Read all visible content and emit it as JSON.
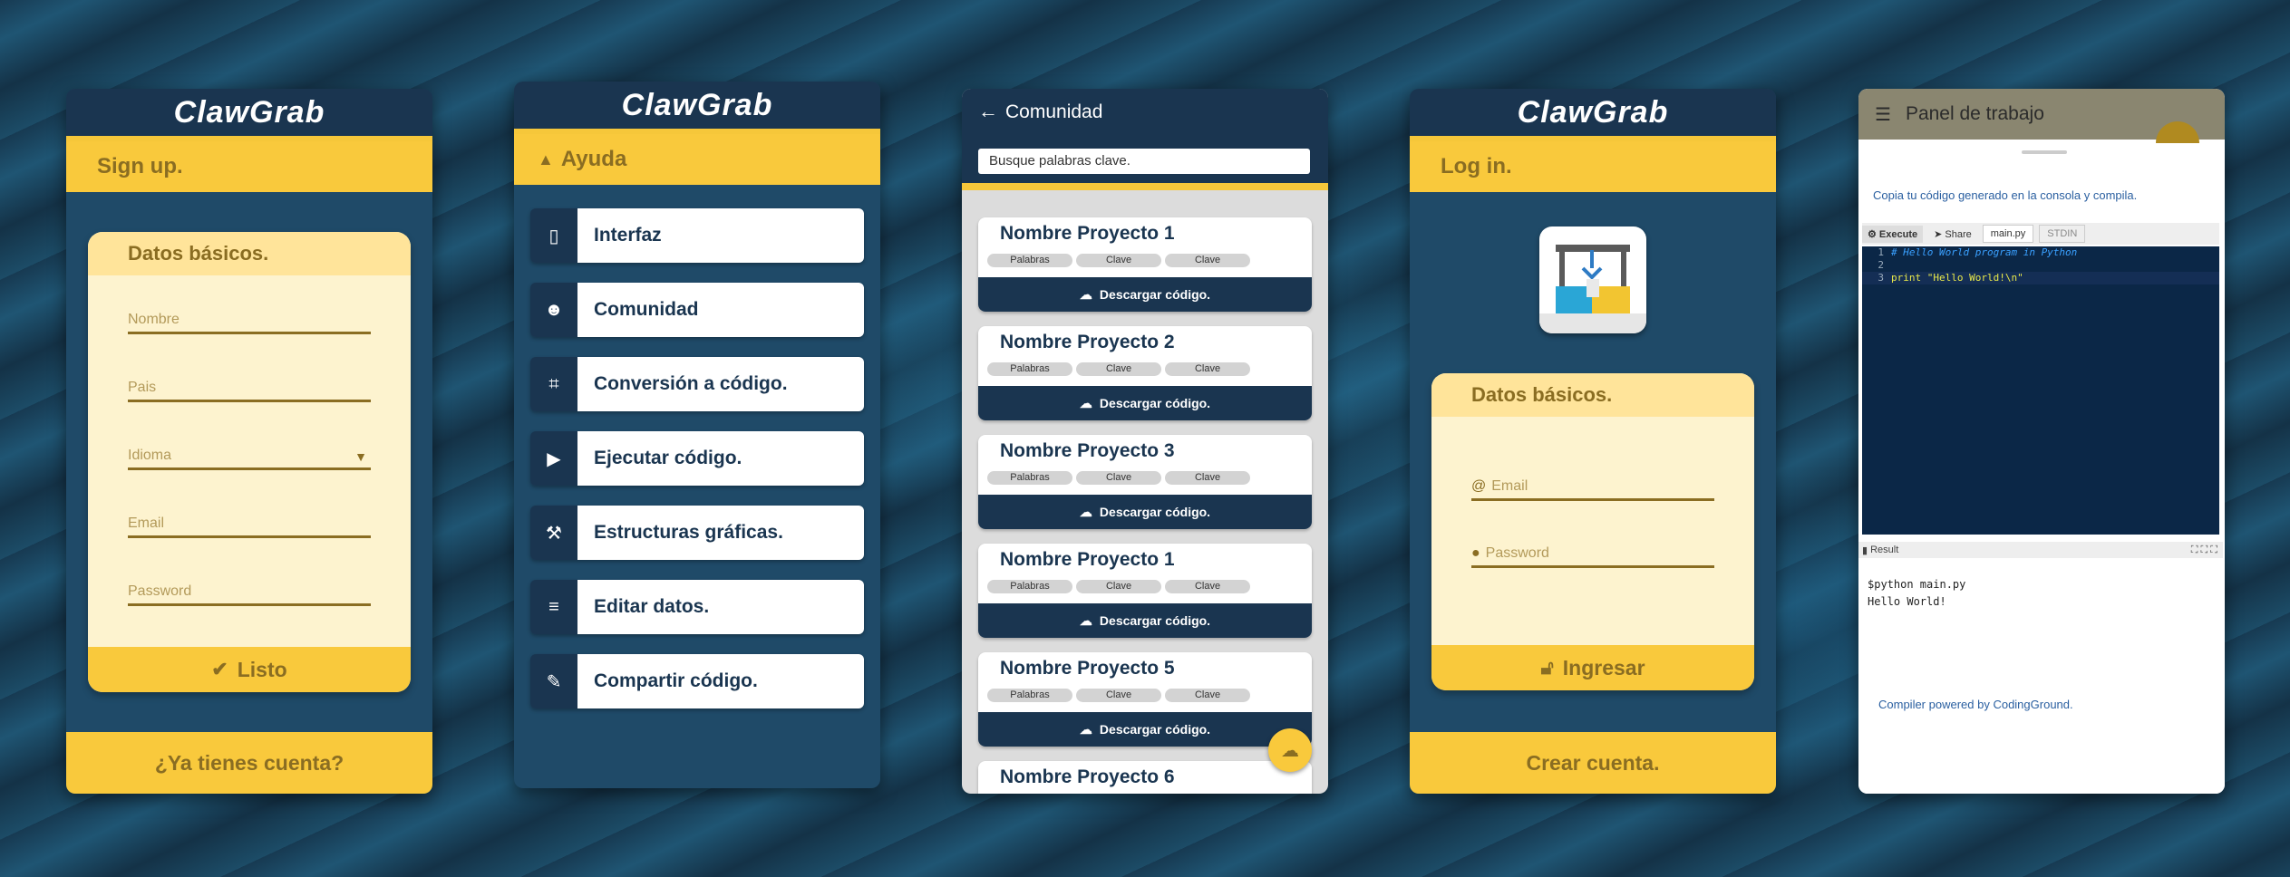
{
  "brand": "ClawGrab",
  "signup": {
    "header": "Sign up.",
    "card_title": "Datos básicos.",
    "fields": [
      "Nombre",
      "Pais",
      "Idioma",
      "Email",
      "Password"
    ],
    "submit": "Listo",
    "bottom": "¿Ya tienes cuenta?"
  },
  "help": {
    "header": "Ayuda",
    "items": [
      "Interfaz",
      "Comunidad",
      "Conversión a código.",
      "Ejecutar código.",
      "Estructuras gráficas.",
      "Editar datos.",
      "Compartir código."
    ]
  },
  "community": {
    "title": "Comunidad",
    "search_placeholder": "Busque palabras clave.",
    "chips": [
      "Palabras",
      "Clave",
      "Clave"
    ],
    "download": "Descargar código.",
    "projects": [
      "Nombre Proyecto 1",
      "Nombre Proyecto 2",
      "Nombre Proyecto 3",
      "Nombre Proyecto 1",
      "Nombre Proyecto 5",
      "Nombre Proyecto 6"
    ]
  },
  "login": {
    "header": "Log in.",
    "card_title": "Datos básicos.",
    "email": "Email",
    "password": "Password",
    "submit": "Ingresar",
    "bottom": "Crear cuenta."
  },
  "workspace": {
    "title": "Panel de trabajo",
    "instruction": "Copia tu código generado en la consola y compila.",
    "tabs": [
      "Execute",
      "Share",
      "main.py",
      "STDIN"
    ],
    "code": [
      "# Hello World program in Python",
      "",
      "print \"Hello World!\\n\""
    ],
    "result_label": "Result",
    "output": [
      "$python main.py",
      "Hello World!"
    ],
    "footer": "Compiler powered by CodingGround."
  }
}
